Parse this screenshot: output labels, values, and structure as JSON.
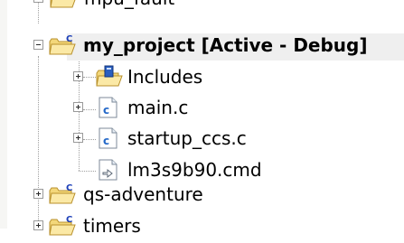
{
  "tree": {
    "items": [
      {
        "label": "mpu_fault",
        "icon": "project-folder-icon"
      },
      {
        "label": "my_project  [Active - Debug]",
        "icon": "project-folder-icon",
        "expanded": true,
        "active": true
      },
      {
        "label": "Includes",
        "icon": "includes-folder-icon"
      },
      {
        "label": "main.c",
        "icon": "c-file-icon"
      },
      {
        "label": "startup_ccs.c",
        "icon": "c-file-icon"
      },
      {
        "label": "lm3s9b90.cmd",
        "icon": "cmd-file-icon"
      },
      {
        "label": "qs-adventure",
        "icon": "project-folder-icon"
      },
      {
        "label": "timers",
        "icon": "project-folder-icon"
      }
    ]
  },
  "colors": {
    "folder": "#f3d77a",
    "project_badge": "#1c3fb8",
    "c_file": "#2468c8",
    "selection": "#efefef"
  }
}
